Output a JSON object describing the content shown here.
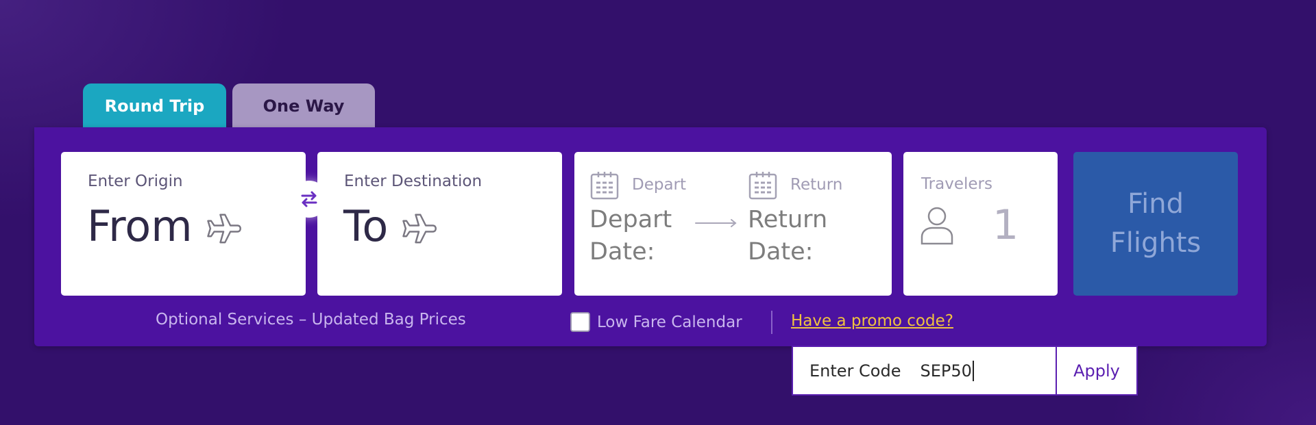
{
  "trip_tabs": [
    {
      "label": "Round Trip",
      "active": true,
      "color": "#1ba7c1"
    },
    {
      "label": "One Way",
      "active": false,
      "color": "#a797c2"
    }
  ],
  "origin": {
    "label": "Enter Origin",
    "value": "From",
    "icon": "airplane-icon"
  },
  "swap": {
    "icon": "swap-arrows-icon"
  },
  "destination": {
    "label": "Enter Destination",
    "value": "To",
    "icon": "airplane-icon"
  },
  "dates": {
    "depart": {
      "label": "Depart",
      "value": "Depart Date:",
      "icon": "calendar-icon"
    },
    "arrow_icon": "long-arrow-right-icon",
    "return": {
      "label": "Return",
      "value": "Return Date:",
      "icon": "calendar-icon"
    }
  },
  "travelers": {
    "label": "Travelers",
    "count": "1",
    "icon": "person-icon"
  },
  "search": {
    "label": "Find Flights",
    "color": "#2b5aa8"
  },
  "footer": {
    "optional_services": "Optional Services – Updated Bag Prices",
    "low_fare_calendar": {
      "label": "Low Fare Calendar",
      "checked": false
    },
    "promo_link": "Have a promo code?"
  },
  "promo": {
    "label": "Enter Code",
    "value": "SEP50",
    "apply_label": "Apply"
  },
  "colors": {
    "background": "#33106b",
    "panel": "#4c12a0",
    "promo_link": "#f0c23f",
    "accent": "#5a1eb0"
  }
}
